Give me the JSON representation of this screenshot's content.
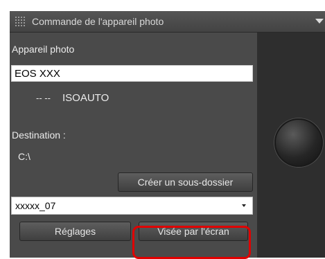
{
  "window": {
    "title": "Commande de l'appareil photo"
  },
  "camera": {
    "section_label": "Appareil photo",
    "model_value": "EOS XXX",
    "dashes": "-- --",
    "iso_value": "ISOAUTO"
  },
  "destination": {
    "label": "Destination :",
    "path": "C:\\",
    "create_folder_label": "Créer un sous-dossier"
  },
  "naming": {
    "selected_value": "xxxxx_07"
  },
  "actions": {
    "settings_label": "Réglages",
    "live_view_label": "Visée par l'écran"
  },
  "colors": {
    "panel_bg": "#4a4a4a",
    "titlebar_bg": "#4e4e4e",
    "highlight": "#e00000"
  },
  "icons": {
    "grip": "grip-icon",
    "collapse": "triangle-down-icon",
    "dropdown": "chevron-down-icon"
  }
}
